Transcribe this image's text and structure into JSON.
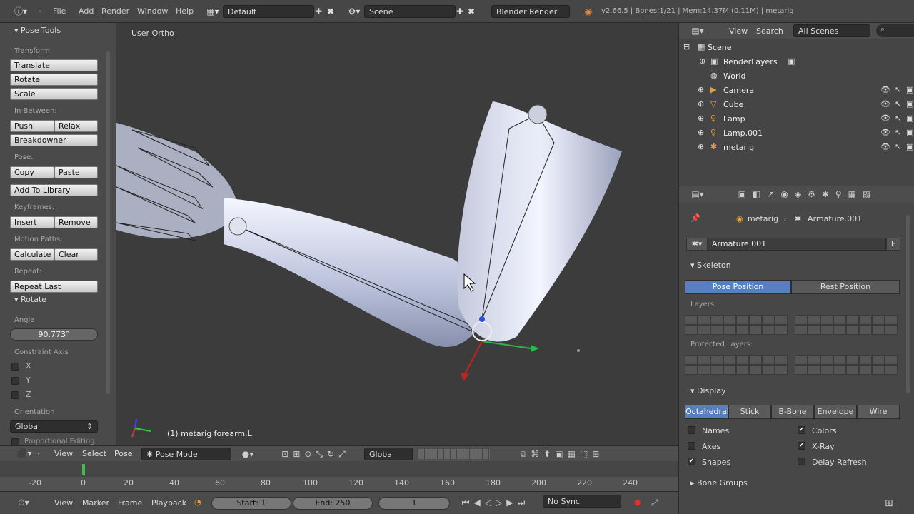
{
  "topbar": {
    "menus": [
      "File",
      "Add",
      "Render",
      "Window",
      "Help"
    ],
    "layout": "Default",
    "scene": "Scene",
    "engine": "Blender Render",
    "stats": "v2.66.5 | Bones:1/21 | Mem:14.37M (0.11M) | metarig"
  },
  "tools": {
    "panel_title": "Pose Tools",
    "transform_label": "Transform:",
    "translate": "Translate",
    "rotate": "Rotate",
    "scale": "Scale",
    "inbetweens_label": "In-Between:",
    "push": "Push",
    "relax": "Relax",
    "breakdowner": "Breakdowner",
    "pose_label": "Pose:",
    "copy": "Copy",
    "paste": "Paste",
    "add_to_library": "Add To Library",
    "keyframes_label": "Keyframes:",
    "insert": "Insert",
    "remove": "Remove",
    "motion_paths_label": "Motion Paths:",
    "calculate": "Calculate",
    "clear": "Clear",
    "repeat_label": "Repeat:",
    "repeat_last": "Repeat Last"
  },
  "operator": {
    "title": "Rotate",
    "angle_label": "Angle",
    "angle_value": "90.773°",
    "constraint_label": "Constraint Axis",
    "axes": [
      "X",
      "Y",
      "Z"
    ],
    "orientation_label": "Orientation",
    "orientation_value": "Global",
    "cut_label": "Proportional Editing"
  },
  "viewport": {
    "view_label": "User Ortho",
    "object_label": "(1) metarig forearm.L"
  },
  "view_header": {
    "view": "View",
    "select": "Select",
    "pose": "Pose",
    "mode": "Pose Mode",
    "orientation": "Global"
  },
  "timeline": {
    "ticks": [
      "-20",
      "0",
      "20",
      "40",
      "60",
      "80",
      "100",
      "120",
      "140",
      "160",
      "180",
      "200",
      "220",
      "240"
    ],
    "view": "View",
    "marker": "Marker",
    "frame": "Frame",
    "playback": "Playback",
    "start": "Start: 1",
    "end": "End: 250",
    "current": "1",
    "sync": "No Sync"
  },
  "outliner": {
    "view": "View",
    "search": "Search",
    "filter": "All Scenes",
    "items": [
      "Scene",
      "RenderLayers",
      "World",
      "Camera",
      "Cube",
      "Lamp",
      "Lamp.001",
      "metarig"
    ]
  },
  "properties": {
    "breadcrumb_obj": "metarig",
    "breadcrumb_data": "Armature.001",
    "data_name": "Armature.001",
    "fake_user": "F",
    "skeleton_title": "Skeleton",
    "pose_position": "Pose Position",
    "rest_position": "Rest Position",
    "layers_label": "Layers:",
    "protected_label": "Protected Layers:",
    "display_title": "Display",
    "display_modes": [
      "Octahedral",
      "Stick",
      "B-Bone",
      "Envelope",
      "Wire"
    ],
    "names": "Names",
    "axes": "Axes",
    "shapes": "Shapes",
    "colors": "Colors",
    "xray": "X-Ray",
    "delay": "Delay Refresh",
    "bone_groups": "Bone Groups"
  },
  "colors": {
    "accent": "#5680c2",
    "bg": "#3b3b3b"
  }
}
